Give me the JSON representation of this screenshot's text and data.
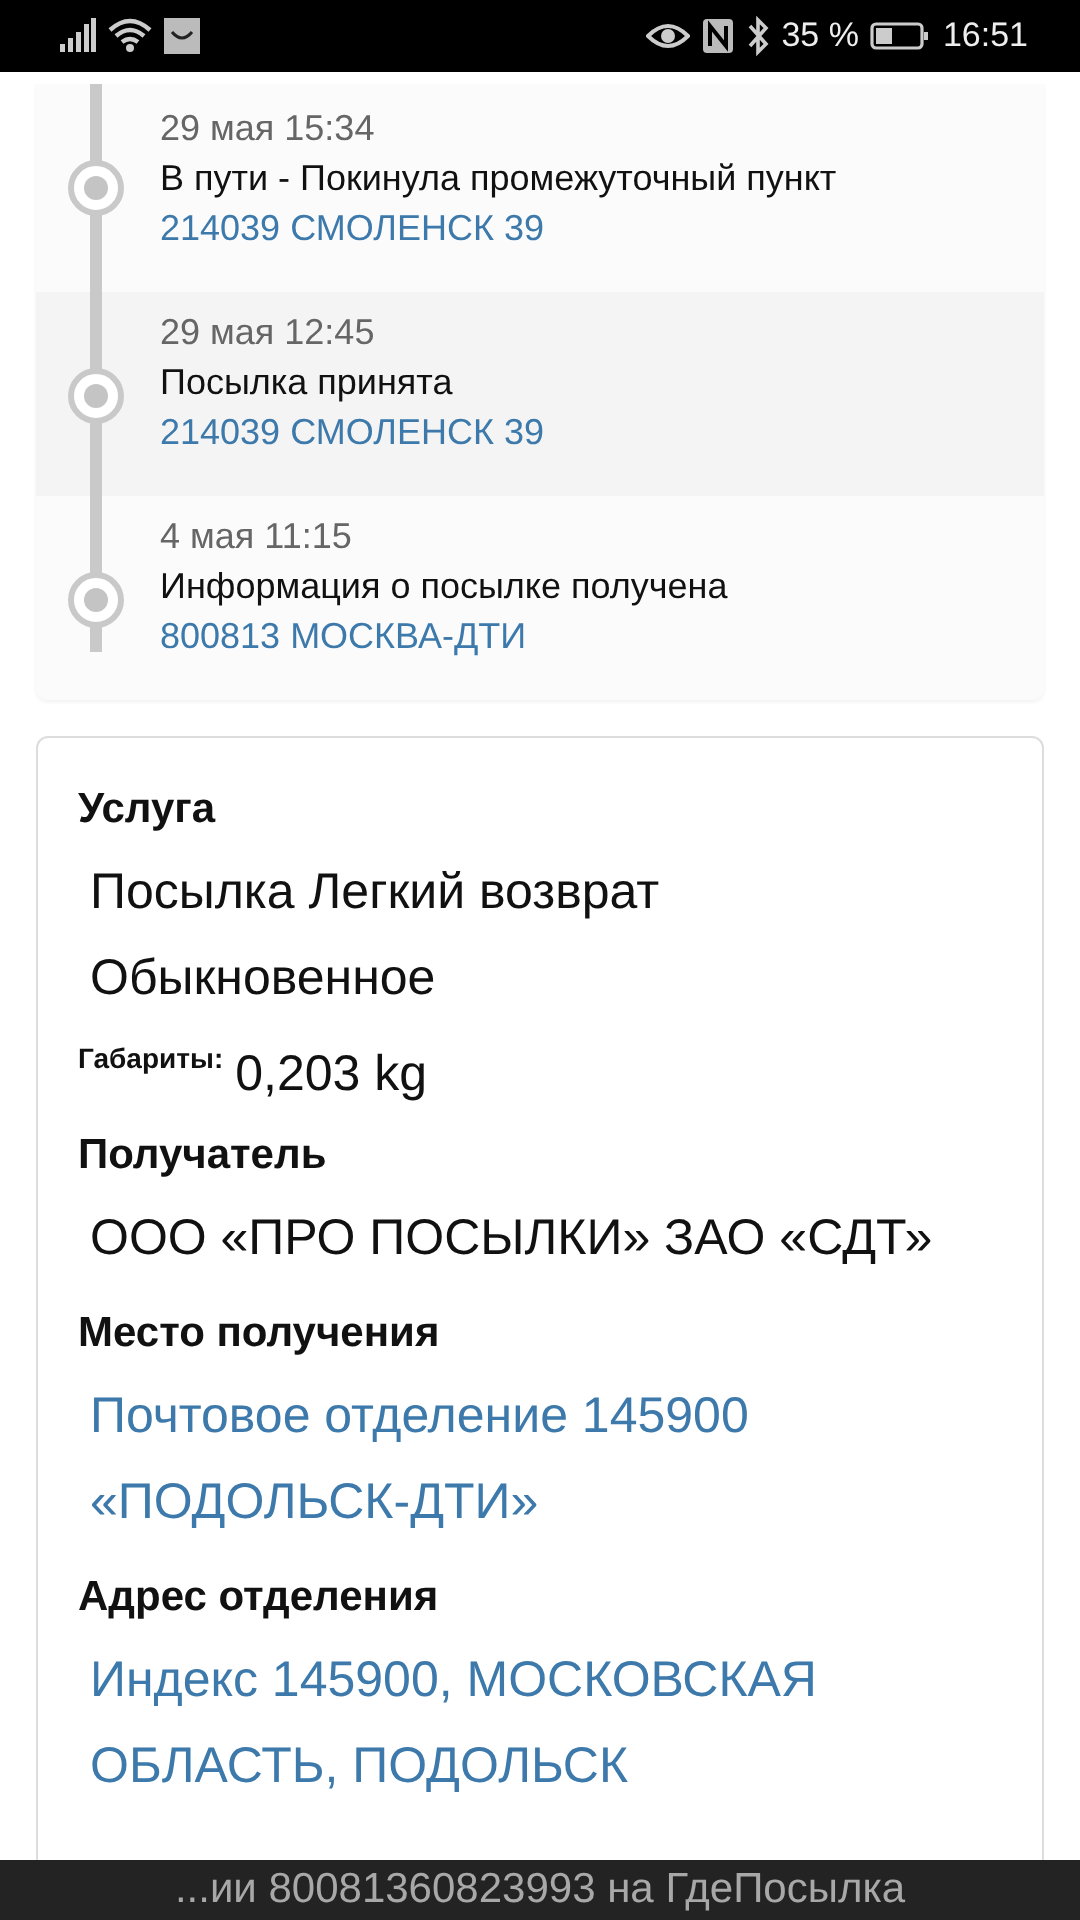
{
  "status_bar": {
    "battery_percent": "35 %",
    "time": "16:51"
  },
  "tracking_events": [
    {
      "date": "29 мая 15:34",
      "status": "В пути - Покинула промежуточный пункт",
      "location": "214039 СМОЛЕНСК 39"
    },
    {
      "date": "29 мая 12:45",
      "status": "Посылка принята",
      "location": "214039 СМОЛЕНСК 39"
    },
    {
      "date": "4 мая 11:15",
      "status": "Информация о посылке получена",
      "location": "800813 МОСКВА-ДТИ"
    }
  ],
  "details": {
    "service_heading": "Услуга",
    "service_lines": [
      "Посылка Легкий возврат",
      "Обыкновенное"
    ],
    "dimensions_label": "Габариты:",
    "dimensions_value": "0,203 kg",
    "recipient_heading": "Получатель",
    "recipient": "ООО «ПРО ПОСЫЛКИ» ЗАО «СДТ»",
    "pickup_heading": "Место получения",
    "pickup": "Почтовое отделение 145900 «ПОДОЛЬСК-ДТИ»",
    "address_heading": "Адрес отделения",
    "address": "Индекс 145900, МОСКОВСКАЯ ОБЛАСТЬ, ПОДОЛЬСК"
  },
  "bottom_banner": "...ии 80081360823993 на ГдеПосылка"
}
